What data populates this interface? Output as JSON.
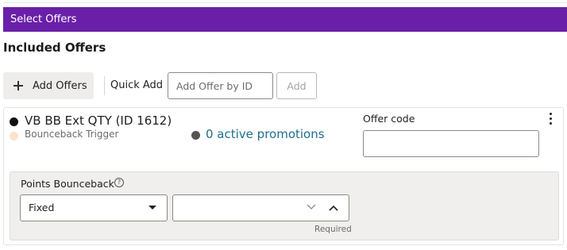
{
  "header": {
    "title": "Select Offers"
  },
  "section": {
    "title": "Included Offers"
  },
  "toolbar": {
    "add_offers_label": "Add Offers",
    "quick_add_label": "Quick Add",
    "offer_id_placeholder": "Add Offer by ID",
    "add_label": "Add"
  },
  "offer": {
    "name": "VB BB Ext QTY (ID 1612)",
    "trigger": "Bounceback Trigger",
    "promotions": "0 active promotions",
    "offer_code_label": "Offer code",
    "offer_code_value": ""
  },
  "points": {
    "label": "Points Bounceback",
    "type_value": "Fixed",
    "amount_value": "",
    "required_text": "Required"
  },
  "icons": [
    "plus-icon",
    "kebab-menu-icon",
    "help-icon",
    "caret-down-icon",
    "chevron-down-icon",
    "chevron-up-icon"
  ],
  "colors": {
    "header_bg": "#6a1fa8",
    "link": "#1f6f8b",
    "trigger_dot": "#fbe3cc",
    "panel_bg": "#f1efed"
  }
}
